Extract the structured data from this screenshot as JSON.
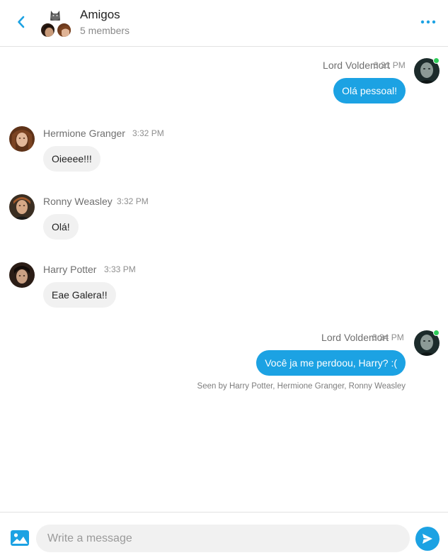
{
  "header": {
    "title": "Amigos",
    "subtitle": "5 members"
  },
  "messages": [
    {
      "sender": "Lord Voldemort",
      "time": "3:31 PM",
      "text": "Olá pessoal!",
      "direction": "outgoing",
      "online": true
    },
    {
      "sender": "Hermione Granger",
      "time": "3:32 PM",
      "text": "Oieeee!!!",
      "direction": "incoming"
    },
    {
      "sender": "Ronny Weasley",
      "time": "3:32 PM",
      "text": "Olá!",
      "direction": "incoming"
    },
    {
      "sender": "Harry Potter",
      "time": "3:33 PM",
      "text": "Eae Galera!!",
      "direction": "incoming"
    },
    {
      "sender": "Lord Voldemort",
      "time": "3:34 PM",
      "text": "Você ja me perdoou, Harry? :(",
      "direction": "outgoing",
      "online": true
    }
  ],
  "seen_text": "Seen by Harry Potter, Hermione Granger, Ronny Weasley",
  "composer": {
    "placeholder": "Write a message"
  },
  "colors": {
    "accent": "#1ca2e3",
    "online": "#2ecc59",
    "incoming_bubble": "#f1f1f1"
  },
  "icons": {
    "back": "chevron-left-icon",
    "more": "more-horizontal-icon",
    "image": "image-icon",
    "send": "send-icon"
  }
}
